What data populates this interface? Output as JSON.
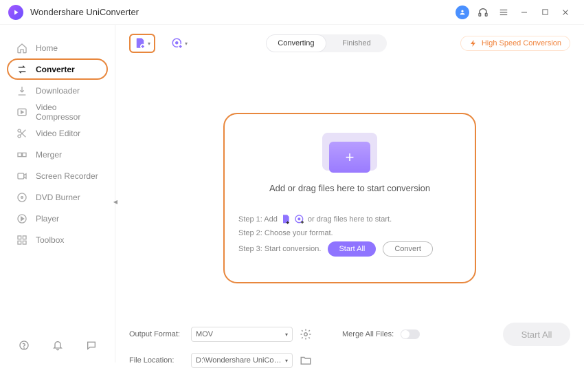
{
  "app": {
    "title": "Wondershare UniConverter"
  },
  "sidebar": {
    "items": [
      {
        "label": "Home"
      },
      {
        "label": "Converter"
      },
      {
        "label": "Downloader"
      },
      {
        "label": "Video Compressor"
      },
      {
        "label": "Video Editor"
      },
      {
        "label": "Merger"
      },
      {
        "label": "Screen Recorder"
      },
      {
        "label": "DVD Burner"
      },
      {
        "label": "Player"
      },
      {
        "label": "Toolbox"
      }
    ]
  },
  "tabs": {
    "converting": "Converting",
    "finished": "Finished"
  },
  "hsc": "High Speed Conversion",
  "drop": {
    "main": "Add or drag files here to start conversion",
    "step1a": "Step 1: Add",
    "step1b": "or drag files here to start.",
    "step2": "Step 2: Choose your format.",
    "step3": "Step 3: Start conversion.",
    "start_all": "Start All",
    "convert": "Convert"
  },
  "bottom": {
    "output_format_label": "Output Format:",
    "output_format_value": "MOV",
    "merge_label": "Merge All Files:",
    "file_location_label": "File Location:",
    "file_location_value": "D:\\Wondershare UniConverter",
    "start_all": "Start All"
  }
}
